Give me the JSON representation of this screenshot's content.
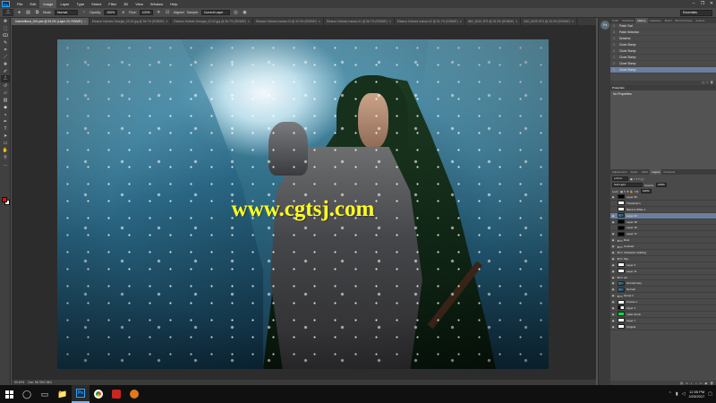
{
  "menubar": {
    "logo": "Ps",
    "items": [
      "File",
      "Edit",
      "Image",
      "Layer",
      "Type",
      "Select",
      "Filter",
      "3D",
      "View",
      "Window",
      "Help"
    ],
    "active_index": 2,
    "window_controls": [
      "–",
      "❐",
      "✕"
    ]
  },
  "optionsbar": {
    "mode_label": "Mode:",
    "mode_value": "Normal",
    "opacity_label": "Opacity:",
    "opacity_value": "100%",
    "flow_label": "Flow:",
    "flow_value": "100%",
    "aligned_label": "Aligned",
    "sample_label": "Sample:",
    "sample_value": "Current Layer",
    "workspace": "Essentials"
  },
  "doctabs": [
    {
      "label": "lrnerevilbust_004.psd @ 53.2% (Layer 20, RGB/8*)",
      "active": true
    },
    {
      "label": "Eleanor Holmes Georgia_03-02.jpg @ 56.7% (RGB/8*)",
      "active": false
    },
    {
      "label": "Eleanor Holmes Georgia_02-02.jpg @ 56.7% (RGB/8*)",
      "active": false
    },
    {
      "label": "Eleanor Holmes Ivanoe-03 @ 33.3% (RGB/8*)",
      "active": false
    },
    {
      "label": "Eleanor Holmes Ivanoe-01 @ 56.7% (RGB/8*)",
      "active": false
    },
    {
      "label": "Eleanor Holmes Ivanoe-02 @ 51.7% (RGB/8*)",
      "active": false
    },
    {
      "label": "IMG_8010.JPG @ 33.3% (RGB/8*)",
      "active": false
    },
    {
      "label": "IMG_8009.JPG @ 33.3% (RGB/8*)",
      "active": false
    }
  ],
  "canvas": {
    "watermark": "www.cgtsj.com"
  },
  "statusbar": {
    "zoom": "53.19%",
    "doc_info": "Doc: 58.7M/2.36G"
  },
  "history_panel": {
    "tabs": [
      "Color",
      "Swatches",
      "History",
      "Character",
      "Brush",
      "Brush Presets",
      "Actions"
    ],
    "active_tab": 2,
    "items": [
      "Patch Tool",
      "Patch Selection",
      "Deselect",
      "Clone Stamp",
      "Clone Stamp",
      "Clone Stamp",
      "Clone Stamp",
      "Clone Stamp"
    ],
    "selected_index": 7
  },
  "properties_panel": {
    "title": "Properties",
    "body": "No Properties"
  },
  "layers_panel": {
    "tabs": [
      "Adjustments",
      "Styles",
      "Paths",
      "Layers",
      "Channels"
    ],
    "active_tab": 3,
    "blend_mode": "Soft Light",
    "opacity_label": "Opacity:",
    "opacity_value": "100%",
    "lock_label": "Lock:",
    "fill_label": "Fill:",
    "fill_value": "100%",
    "layers": [
      {
        "name": "Layer 30",
        "thumb": "black",
        "visible": true
      },
      {
        "name": "Threshold 1",
        "thumb": "white",
        "visible": false
      },
      {
        "name": "Black & White 1",
        "thumb": "white",
        "visible": false
      },
      {
        "name": "Layer 20",
        "thumb": "photo",
        "visible": true,
        "selected": true
      },
      {
        "name": "Layer 18",
        "thumb": "black",
        "visible": true
      },
      {
        "name": "Layer 19",
        "thumb": "black",
        "visible": false
      },
      {
        "name": "Layer 17",
        "thumb": "black",
        "visible": true
      },
      {
        "name": "Dust",
        "thumb": "folder",
        "visible": true
      },
      {
        "name": "Contrast",
        "thumb": "folder",
        "visible": true
      },
      {
        "name": "Character Clothing",
        "thumb": "folder",
        "visible": true
      },
      {
        "name": "Sky",
        "thumb": "folder",
        "visible": true
      },
      {
        "name": "Layer 4",
        "thumb": "white",
        "visible": true
      },
      {
        "name": "Layer 11",
        "thumb": "white",
        "visible": true
      },
      {
        "name": "Ice",
        "thumb": "folder",
        "visible": true
      },
      {
        "name": "Normal copy",
        "thumb": "photo",
        "visible": true
      },
      {
        "name": "Normal",
        "thumb": "photo",
        "visible": true
      },
      {
        "name": "Group 1",
        "thumb": "folder",
        "visible": true
      },
      {
        "name": "Curves 1",
        "thumb": "white",
        "visible": true
      },
      {
        "name": "Layer 1",
        "thumb": "mask",
        "visible": true
      },
      {
        "name": "mask check",
        "thumb": "green",
        "visible": true
      },
      {
        "name": "Layer 7",
        "thumb": "white",
        "visible": true
      },
      {
        "name": "Original",
        "thumb": "white",
        "visible": true
      }
    ],
    "footer_icons": [
      "⛓",
      "fx",
      "◐",
      "◑",
      "▭",
      "▣",
      "🗑"
    ]
  },
  "taskbar": {
    "time": "12:05 PM",
    "date": "2/23/2017"
  }
}
